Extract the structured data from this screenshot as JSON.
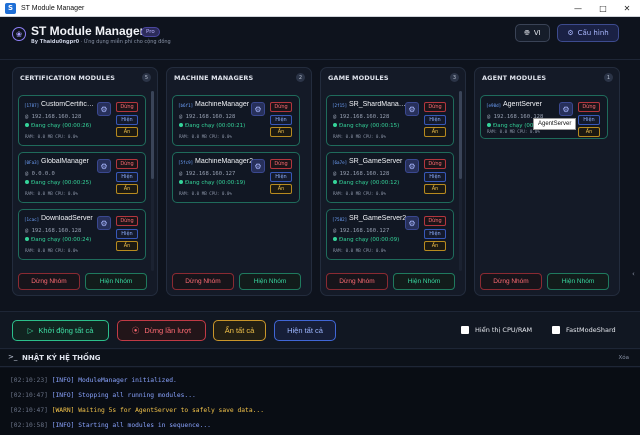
{
  "window": {
    "title": "ST Module Manager",
    "icon_letter": "S"
  },
  "header": {
    "title": "ST Module Manager",
    "badge": "Pro",
    "byline": "By Thaidu0ngpr0",
    "tagline": " · Ứng dụng miễn phí cho cộng đồng",
    "lang_label": "VI",
    "config_label": "Cấu hình"
  },
  "columns": [
    {
      "title": "CERTIFICATION MODULES",
      "count": "5",
      "stop_group": "Dừng Nhóm",
      "show_group": "Hiện Nhóm",
      "cards": [
        {
          "port": "[1787]",
          "name": "CustomCertific…",
          "ip": "@ 192.168.160.128",
          "status": "Đang chạy (00:00:26)",
          "stats": "RAM: 0.0 MB  CPU: 0.0%",
          "stop": "Dừng",
          "show": "Hiện",
          "hide": "Ẩn"
        },
        {
          "port": "[0Fa3]",
          "name": "GlobalManager",
          "ip": "@ 0.0.0.0",
          "status": "Đang chạy (00:00:25)",
          "stats": "RAM: 0.0 MB  CPU: 0.0%",
          "stop": "Dừng",
          "show": "Hiện",
          "hide": "Ẩn"
        },
        {
          "port": "[1cac]",
          "name": "DownloadServer",
          "ip": "@ 192.168.160.128",
          "status": "Đang chạy (00:00:24)",
          "stats": "RAM: 0.0 MB  CPU: 0.0%",
          "stop": "Dừng",
          "show": "Hiện",
          "hide": "Ẩn"
        }
      ]
    },
    {
      "title": "MACHINE MANAGERS",
      "count": "2",
      "stop_group": "Dừng Nhóm",
      "show_group": "Hiện Nhóm",
      "cards": [
        {
          "port": "[b6f1]",
          "name": "MachineManager",
          "ip": "@ 192.168.160.128",
          "status": "Đang chạy (00:00:21)",
          "stats": "RAM: 0.0 MB  CPU: 0.0%",
          "stop": "Dừng",
          "show": "Hiện",
          "hide": "Ẩn"
        },
        {
          "port": "[5fc9]",
          "name": "MachineManager2",
          "ip": "@ 192.168.160.127",
          "status": "Đang chạy (00:00:19)",
          "stats": "RAM: 0.0 MB  CPU: 0.0%",
          "stop": "Dừng",
          "show": "Hiện",
          "hide": "Ẩn"
        }
      ]
    },
    {
      "title": "GAME MODULES",
      "count": "3",
      "stop_group": "Dừng Nhóm",
      "show_group": "Hiện Nhóm",
      "cards": [
        {
          "port": "[2f15]",
          "name": "SR_ShardMana…",
          "ip": "@ 192.168.160.128",
          "status": "Đang chạy (00:00:15)",
          "stats": "RAM: 0.0 MB  CPU: 0.0%",
          "stop": "Dừng",
          "show": "Hiện",
          "hide": "Ẩn"
        },
        {
          "port": "[6a7e]",
          "name": "SR_GameServer",
          "ip": "@ 192.168.160.128",
          "status": "Đang chạy (00:00:12)",
          "stats": "RAM: 0.0 MB  CPU: 0.0%",
          "stop": "Dừng",
          "show": "Hiện",
          "hide": "Ẩn"
        },
        {
          "port": "[7582]",
          "name": "SR_GameServer2",
          "ip": "@ 192.168.160.127",
          "status": "Đang chạy (00:00:09)",
          "stats": "RAM: 0.0 MB  CPU: 0.0%",
          "stop": "Dừng",
          "show": "Hiện",
          "hide": "Ẩn"
        }
      ]
    },
    {
      "title": "AGENT MODULES",
      "count": "1",
      "stop_group": "Dừng Nhóm",
      "show_group": "Hiện Nhóm",
      "cards": [
        {
          "port": "[e90d]",
          "name": "AgentServer",
          "ip": "@ 192.168.160.128",
          "status": "Đang chạy (00:00:…",
          "stats": "RAM: 0.0 MB  CPU: 0.0%",
          "stop": "Dừng",
          "show": "Hiện",
          "hide": "Ẩn"
        }
      ]
    }
  ],
  "tooltip": "AgentServer",
  "actions": {
    "start_all": "Khởi động tất cả",
    "stop_sequential": "Dừng lần lượt",
    "hide_all": "Ẩn tất cả",
    "show_all": "Hiện tất cả",
    "show_cpu_ram": "Hiển thị CPU/RAM",
    "fast_mode": "FastModeShard"
  },
  "log": {
    "title": "NHẬT KÝ HỆ THỐNG",
    "clear": "Xóa",
    "lines": [
      {
        "ts": "[02:10:23]",
        "level": "info",
        "msg": "[INFO] ModuleManager initialized."
      },
      {
        "ts": "[02:10:47]",
        "level": "info",
        "msg": "[INFO] Stopping all running modules..."
      },
      {
        "ts": "[02:10:47]",
        "level": "warn",
        "msg": "[WARN] Waiting 5s for AgentServer to safely save data..."
      },
      {
        "ts": "[02:10:58]",
        "level": "info",
        "msg": "[INFO] Starting all modules in sequence..."
      }
    ]
  },
  "colors": {
    "accent": "#8d7ff5",
    "running": "#35d49a",
    "danger": "#ff6b73",
    "warn": "#f3c34a",
    "info": "#8aa4ff"
  }
}
